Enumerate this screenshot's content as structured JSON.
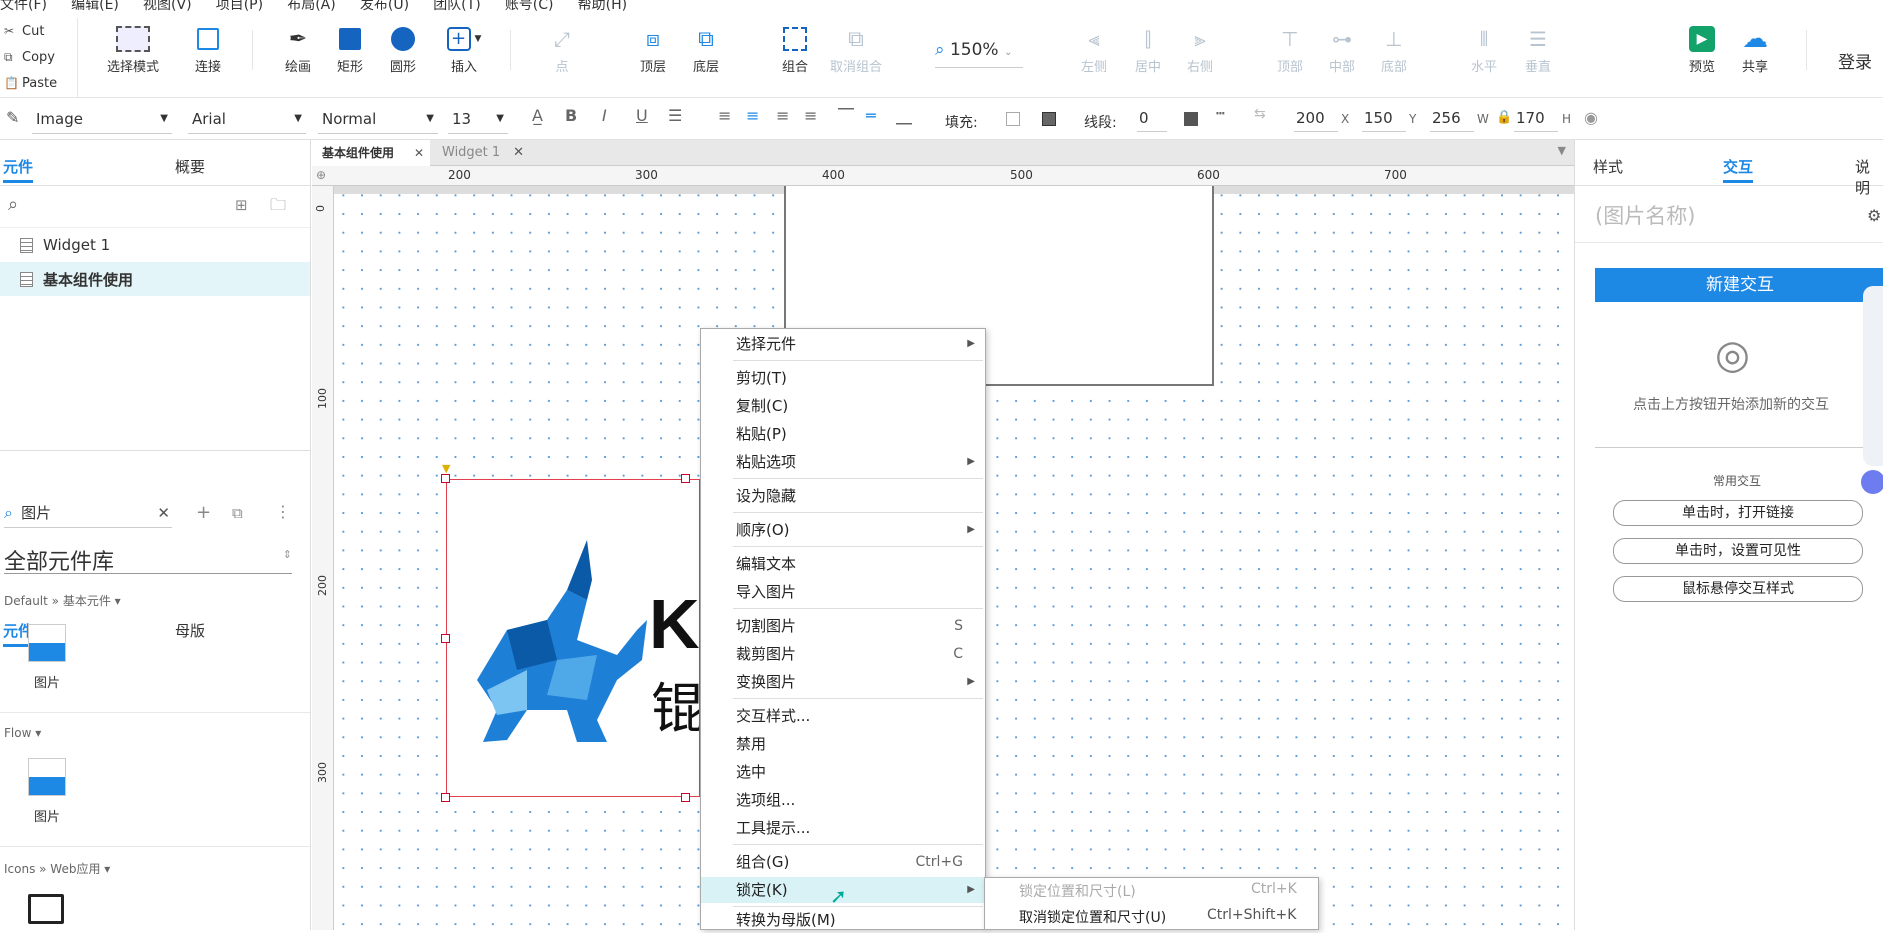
{
  "menubar": {
    "items": [
      "文件(F)",
      "编辑(E)",
      "视图(V)",
      "项目(P)",
      "布局(A)",
      "发布(U)",
      "团队(T)",
      "账号(C)",
      "帮助(H)"
    ]
  },
  "clipboard": {
    "cut": "Cut",
    "copy": "Copy",
    "paste": "Paste"
  },
  "toolbar": {
    "select_mode": "选择模式",
    "connect": "连接",
    "draw": "绘画",
    "rect": "矩形",
    "circle": "圆形",
    "insert": "插入",
    "point": "点",
    "top_layer": "顶层",
    "bottom_layer": "底层",
    "group": "组合",
    "ungroup": "取消组合",
    "zoom": "150%",
    "align_left": "左侧",
    "align_center": "居中",
    "align_right": "右侧",
    "align_top": "顶部",
    "align_middle": "中部",
    "align_bottom": "底部",
    "dist_h": "水平",
    "dist_v": "垂直",
    "preview": "预览",
    "share": "共享",
    "login": "登录"
  },
  "format": {
    "style": "Image",
    "font": "Arial",
    "weight": "Normal",
    "size": "13",
    "fill_label": "填充:",
    "line_label": "线段:",
    "line_value": "0",
    "x": "200",
    "x_label": "X",
    "y": "150",
    "y_label": "Y",
    "w": "256",
    "w_label": "W",
    "h": "170",
    "h_label": "H"
  },
  "left_top": {
    "tab_pages": "元件",
    "tab_outline": "概要",
    "pages": [
      "Widget 1",
      "基本组件使用"
    ]
  },
  "left_bottom": {
    "tab_widgets": "元件",
    "tab_masters": "母版",
    "search_value": "图片",
    "library": "全部元件库",
    "group1": "Default » 基本元件 ▾",
    "group1_item": "图片",
    "group2": "Flow ▾",
    "group2_item": "图片",
    "group3": "Icons » Web应用 ▾"
  },
  "doctabs": [
    "基本组件使用",
    "Widget 1"
  ],
  "ruler_h": [
    "200",
    "300",
    "400",
    "500",
    "600",
    "700"
  ],
  "ruler_v": [
    "0",
    "100",
    "200",
    "300"
  ],
  "context_menu": {
    "select_widget": "选择元件",
    "cut": "剪切(T)",
    "copy": "复制(C)",
    "paste": "粘贴(P)",
    "paste_options": "粘贴选项",
    "set_hidden": "设为隐藏",
    "order": "顺序(O)",
    "edit_text": "编辑文本",
    "import_image": "导入图片",
    "slice_image": "切割图片",
    "slice_key": "S",
    "crop_image": "裁剪图片",
    "crop_key": "C",
    "transform_image": "变换图片",
    "interaction_styles": "交互样式...",
    "disabled": "禁用",
    "selected": "选中",
    "selection_group": "选项组...",
    "tooltip": "工具提示...",
    "group": "组合(G)",
    "group_key": "Ctrl+G",
    "lock": "锁定(K)",
    "convert_master": "转换为母版(M)"
  },
  "submenu": {
    "lock_pos": "锁定位置和尺寸(L)",
    "lock_key": "Ctrl+K",
    "unlock_pos": "取消锁定位置和尺寸(U)",
    "unlock_key": "Ctrl+Shift+K"
  },
  "right": {
    "tab_style": "样式",
    "tab_interact": "交互",
    "tab_notes": "说明",
    "name_placeholder": "(图片名称)",
    "new_btn": "新建交互",
    "hint": "点击上方按钮开始添加新的交互",
    "common": "常用交互",
    "btn1": "单击时，打开链接",
    "btn2": "单击时，设置可见性",
    "btn3": "鼠标悬停交互样式"
  },
  "logo_text": {
    "letter": "K",
    "cn": "锟"
  }
}
